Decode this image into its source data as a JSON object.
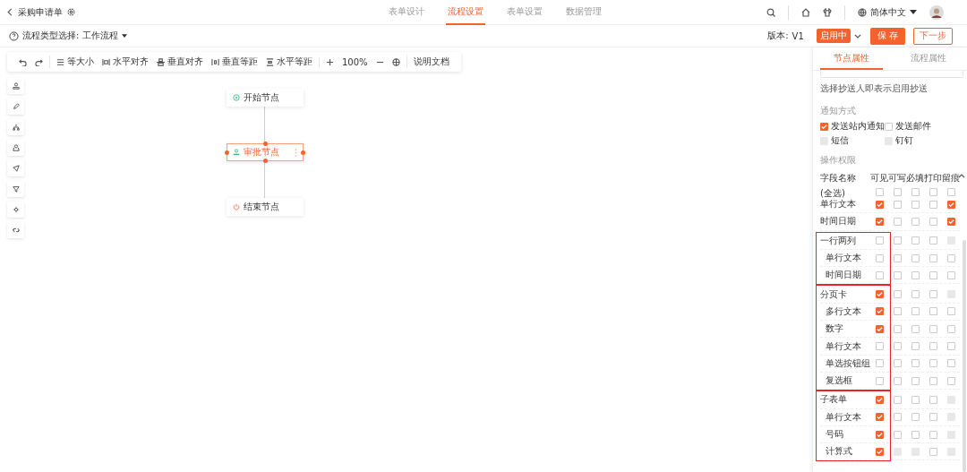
{
  "header": {
    "title": "采购申请单",
    "language": "简体中文",
    "tabs": [
      {
        "label": "表单设计",
        "selected": false
      },
      {
        "label": "流程设置",
        "selected": true
      },
      {
        "label": "表单设置",
        "selected": false
      },
      {
        "label": "数据管理",
        "selected": false
      }
    ]
  },
  "subbar": {
    "flow_type_label": "流程类型选择:",
    "flow_type_value": "工作流程",
    "version_label": "版本:",
    "version": "V1",
    "status": "启用中",
    "save": "保 存",
    "next": "下一步"
  },
  "toolbar": {
    "groups": [
      [
        {
          "kind": "undo"
        },
        {
          "kind": "redo"
        }
      ],
      [
        {
          "kind": "same-size",
          "label": "等大小"
        },
        {
          "kind": "h-align",
          "label": "水平对齐"
        },
        {
          "kind": "v-align",
          "label": "垂直对齐"
        },
        {
          "kind": "v-space",
          "label": "垂直等距"
        },
        {
          "kind": "h-space",
          "label": "水平等距"
        }
      ],
      [
        {
          "kind": "plus"
        },
        {
          "kind": "text",
          "label": "100%"
        },
        {
          "kind": "minus"
        },
        {
          "kind": "fit"
        }
      ],
      [
        {
          "kind": "text",
          "label": "说明文档"
        }
      ]
    ]
  },
  "nodes": [
    {
      "label": "开始节点",
      "kind": "start",
      "selected": false
    },
    {
      "label": "审批节点",
      "kind": "approve",
      "selected": true
    },
    {
      "label": "结束节点",
      "kind": "end",
      "selected": false
    }
  ],
  "panel": {
    "tabs": [
      {
        "label": "节点属性",
        "selected": true
      },
      {
        "label": "流程属性",
        "selected": false
      }
    ],
    "cc_hint": "选择抄送人即表示启用抄送",
    "notify": {
      "title": "通知方式",
      "options": [
        {
          "label": "发送站内通知",
          "checked": true,
          "disabled": false
        },
        {
          "label": "发送邮件",
          "checked": false,
          "disabled": false
        },
        {
          "label": "短信",
          "checked": false,
          "disabled": true
        },
        {
          "label": "钉钉",
          "checked": false,
          "disabled": true
        }
      ]
    },
    "permissions": {
      "title": "操作权限",
      "name_header": "字段名称",
      "select_all": "(全选)",
      "columns": [
        "可见",
        "可写",
        "必填",
        "打印",
        "留痕"
      ],
      "select_all_checks": [
        false,
        false,
        false,
        false,
        false
      ],
      "groups": [
        {
          "highlighted": false,
          "rows": [
            {
              "name": "单行文本",
              "checks": [
                true,
                false,
                false,
                false,
                true
              ],
              "disabled": [
                false,
                false,
                false,
                false,
                false
              ]
            },
            {
              "name": "时间日期",
              "checks": [
                true,
                false,
                false,
                false,
                true
              ],
              "disabled": [
                false,
                false,
                false,
                false,
                false
              ]
            }
          ]
        },
        {
          "highlighted": true,
          "rows": [
            {
              "name": "一行两列",
              "checks": [
                false,
                false,
                false,
                false,
                false
              ],
              "disabled": [
                false,
                false,
                false,
                false,
                true
              ],
              "children": [
                {
                  "name": "单行文本",
                  "checks": [
                    false,
                    false,
                    false,
                    false,
                    false
                  ],
                  "disabled": [
                    false,
                    false,
                    false,
                    false,
                    false
                  ]
                },
                {
                  "name": "时间日期",
                  "checks": [
                    false,
                    false,
                    false,
                    false,
                    false
                  ],
                  "disabled": [
                    false,
                    false,
                    false,
                    false,
                    false
                  ]
                }
              ]
            }
          ]
        },
        {
          "highlighted": true,
          "rows": [
            {
              "name": "分页卡",
              "checks": [
                true,
                false,
                false,
                false,
                false
              ],
              "disabled": [
                false,
                false,
                false,
                false,
                true
              ],
              "children": [
                {
                  "name": "多行文本",
                  "checks": [
                    true,
                    false,
                    false,
                    false,
                    false
                  ],
                  "disabled": [
                    false,
                    false,
                    false,
                    false,
                    false
                  ]
                },
                {
                  "name": "数字",
                  "checks": [
                    true,
                    false,
                    false,
                    false,
                    false
                  ],
                  "disabled": [
                    false,
                    false,
                    false,
                    false,
                    false
                  ]
                },
                {
                  "name": "单行文本",
                  "checks": [
                    false,
                    false,
                    false,
                    false,
                    false
                  ],
                  "disabled": [
                    false,
                    false,
                    false,
                    false,
                    false
                  ]
                },
                {
                  "name": "单选按钮组",
                  "checks": [
                    false,
                    false,
                    false,
                    false,
                    false
                  ],
                  "disabled": [
                    false,
                    false,
                    false,
                    false,
                    false
                  ]
                },
                {
                  "name": "复选框",
                  "checks": [
                    false,
                    false,
                    false,
                    false,
                    false
                  ],
                  "disabled": [
                    false,
                    false,
                    false,
                    false,
                    false
                  ]
                }
              ]
            }
          ]
        },
        {
          "highlighted": true,
          "rows": [
            {
              "name": "子表单",
              "checks": [
                true,
                false,
                false,
                false,
                false
              ],
              "disabled": [
                false,
                false,
                false,
                false,
                true
              ],
              "children": [
                {
                  "name": "单行文本",
                  "checks": [
                    true,
                    false,
                    false,
                    false,
                    false
                  ],
                  "disabled": [
                    false,
                    false,
                    false,
                    false,
                    true
                  ]
                },
                {
                  "name": "号码",
                  "checks": [
                    true,
                    false,
                    false,
                    false,
                    false
                  ],
                  "disabled": [
                    false,
                    false,
                    false,
                    false,
                    true
                  ]
                },
                {
                  "name": "计算式",
                  "checks": [
                    true,
                    false,
                    false,
                    false,
                    false
                  ],
                  "disabled": [
                    false,
                    true,
                    true,
                    false,
                    true
                  ]
                }
              ]
            }
          ]
        }
      ]
    }
  }
}
